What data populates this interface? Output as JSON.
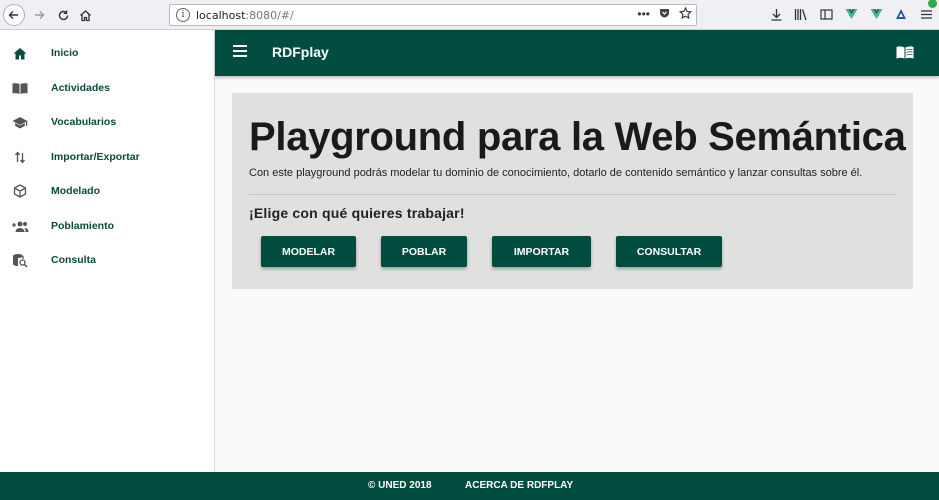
{
  "browser": {
    "url_host": "localhost",
    "url_rest": ":8080/#/",
    "colors": {
      "toolbar": "#f0f0f4"
    }
  },
  "sidebar": {
    "items": [
      {
        "label": "Inicio",
        "icon": "home-icon"
      },
      {
        "label": "Actividades",
        "icon": "book-open-icon"
      },
      {
        "label": "Vocabularios",
        "icon": "school-icon"
      },
      {
        "label": "Importar/Exportar",
        "icon": "import-export-icon"
      },
      {
        "label": "Modelado",
        "icon": "cube-icon"
      },
      {
        "label": "Poblamiento",
        "icon": "group-add-icon"
      },
      {
        "label": "Consulta",
        "icon": "database-search-icon"
      }
    ]
  },
  "appbar": {
    "title": "RDFplay",
    "color": "#004d40"
  },
  "hero": {
    "title": "Playground para la Web Semántica",
    "subtitle": "Con este playground podrás modelar tu dominio de conocimiento, dotarlo de contenido semántico y lanzar consultas sobre él.",
    "prompt": "¡Elige con qué quieres trabajar!",
    "buttons": {
      "modelar": "MODELAR",
      "poblar": "POBLAR",
      "importar": "IMPORTAR",
      "consultar": "CONSULTAR"
    }
  },
  "footer": {
    "copyright": "© UNED 2018",
    "about_link": "ACERCA DE RDFPLAY"
  }
}
